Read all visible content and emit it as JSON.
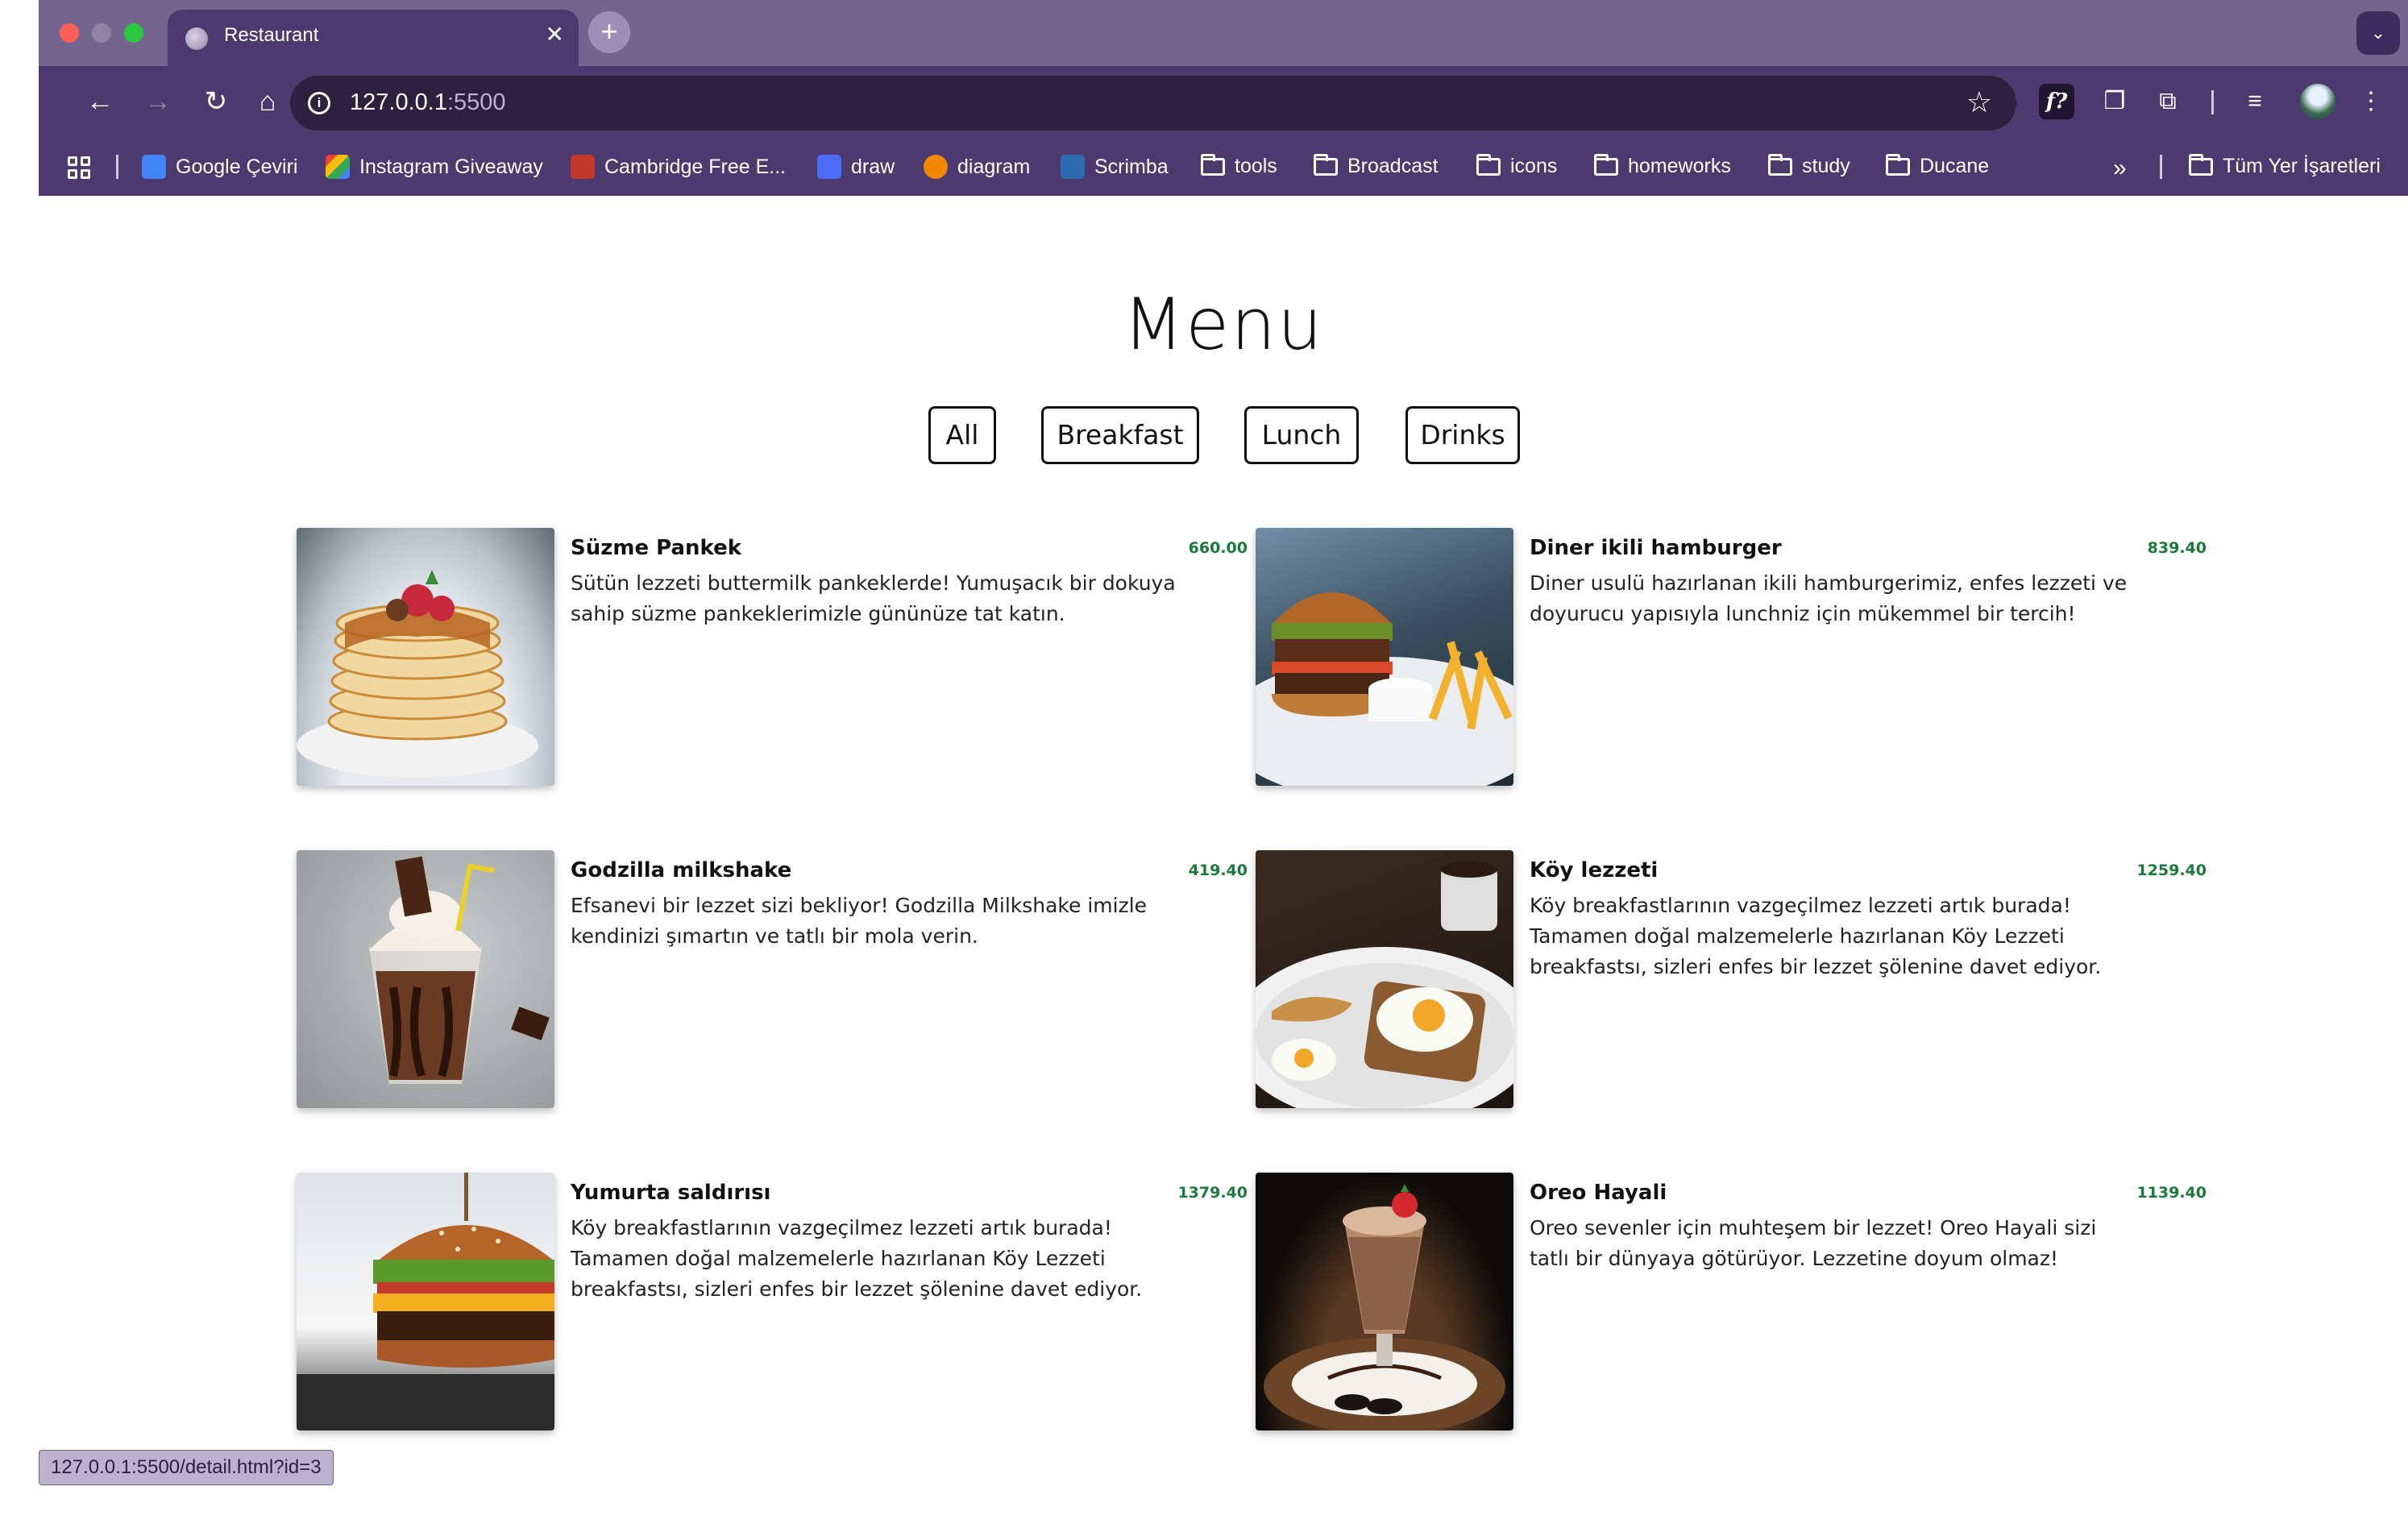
{
  "browser": {
    "tab_title": "Restaurant",
    "url_host": "127.0.0.1",
    "url_port": ":5500",
    "status_url": "127.0.0.1:5500/detail.html?id=3",
    "bookmarks": [
      {
        "label": "Google Çeviri",
        "icon": "google-translate-icon",
        "color": "#4285f4"
      },
      {
        "label": "Instagram Giveaway",
        "icon": "instagram-giveaway-icon",
        "color": "#e1306c"
      },
      {
        "label": "Cambridge Free E...",
        "icon": "cambridge-icon",
        "color": "#c0392b"
      },
      {
        "label": "draw",
        "icon": "draw-icon",
        "color": "#4a6cf7"
      },
      {
        "label": "diagram",
        "icon": "diagram-icon",
        "color": "#f08705"
      },
      {
        "label": "Scrimba",
        "icon": "scrimba-icon",
        "color": "#2b6cb0"
      },
      {
        "label": "tools",
        "icon": "folder-icon"
      },
      {
        "label": "Broadcast",
        "icon": "folder-icon"
      },
      {
        "label": "icons",
        "icon": "folder-icon"
      },
      {
        "label": "homeworks",
        "icon": "folder-icon"
      },
      {
        "label": "study",
        "icon": "folder-icon"
      },
      {
        "label": "Ducane",
        "icon": "folder-icon"
      }
    ],
    "all_bookmarks_label": "Tüm Yer İşaretleri",
    "overflow_label": "»"
  },
  "page": {
    "title": "Menu",
    "filters": [
      "All",
      "Breakfast",
      "Lunch",
      "Drinks"
    ],
    "items": [
      {
        "name": "Süzme Pankek",
        "price": "660.00",
        "desc": "Sütün lezzeti buttermilk pankeklerde! Yumuşacık bir dokuya sahip süzme pankeklerimizle gününüze tat katın."
      },
      {
        "name": "Diner ikili hamburger",
        "price": "839.40",
        "desc": "Diner usulü hazırlanan ikili hamburgerimiz, enfes lezzeti ve doyurucu yapısıyla lunchniz için mükemmel bir tercih!"
      },
      {
        "name": "Godzilla milkshake",
        "price": "419.40",
        "desc": "Efsanevi bir lezzet sizi bekliyor! Godzilla Milkshake imizle kendinizi şımartın ve tatlı bir mola verin."
      },
      {
        "name": "Köy lezzeti",
        "price": "1259.40",
        "desc": "Köy breakfastlarının vazgeçilmez lezzeti artık burada! Tamamen doğal malzemelerle hazırlanan Köy Lezzeti breakfastsı, sizleri enfes bir lezzet şölenine davet ediyor."
      },
      {
        "name": "Yumurta saldırısı",
        "price": "1379.40",
        "desc": "Köy breakfastlarının vazgeçilmez lezzeti artık burada! Tamamen doğal malzemelerle hazırlanan Köy Lezzeti breakfastsı, sizleri enfes bir lezzet şölenine davet ediyor."
      },
      {
        "name": "Oreo Hayali",
        "price": "1139.40",
        "desc": "Oreo sevenler için muhteşem bir lezzet! Oreo Hayali sizi tatlı bir dünyaya götürüyor. Lezzetine doyum olmaz!"
      }
    ]
  },
  "colors": {
    "chrome_frame": "#4c3a6f",
    "tab_strip": "#74658f",
    "price_green": "#1a7a3a"
  }
}
